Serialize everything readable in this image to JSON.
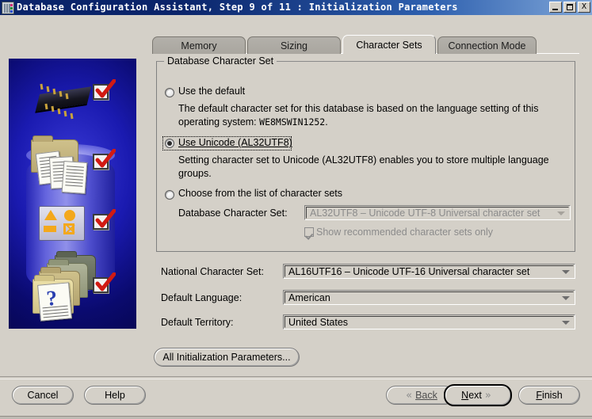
{
  "window": {
    "title": "Database Configuration Assistant, Step 9 of 11 : Initialization Parameters",
    "icon": "database-server-icon",
    "controls": {
      "minimize": "_",
      "maximize": "□",
      "close": "X"
    }
  },
  "sidebar": {
    "icon_names": [
      "chip-icon",
      "folder-documents-icon",
      "shapes-icon",
      "question-documents-icon"
    ],
    "check_marks": 4
  },
  "tabs": [
    {
      "label": "Memory",
      "active": false
    },
    {
      "label": "Sizing",
      "active": false
    },
    {
      "label": "Character Sets",
      "active": true
    },
    {
      "label": "Connection Mode",
      "active": false
    }
  ],
  "group": {
    "title": "Database Character Set",
    "options": [
      {
        "id": "use-default",
        "label": "Use the default",
        "selected": false,
        "description_line1": "The default character set for this database is based on the language setting of this",
        "description_line2_prefix": "operating system: ",
        "description_line2_value": "WE8MSWIN1252",
        "description_line2_suffix": "."
      },
      {
        "id": "use-unicode",
        "label": "Use Unicode (AL32UTF8)",
        "selected": true,
        "focused": true,
        "description_line1": "Setting character set to Unicode (AL32UTF8) enables you to store multiple language",
        "description_line2": "groups."
      },
      {
        "id": "choose-from-list",
        "label": "Choose from the list of character sets",
        "selected": false
      }
    ],
    "database_character_set": {
      "label": "Database Character Set:",
      "value": "AL32UTF8 – Unicode UTF-8 Universal character set",
      "disabled": true
    },
    "show_recommended": {
      "label": "Show recommended character sets only",
      "checked": true,
      "disabled": true
    }
  },
  "fields": [
    {
      "id": "national-character-set",
      "label": "National Character Set:",
      "value": "AL16UTF16 – Unicode UTF-16 Universal character set"
    },
    {
      "id": "default-language",
      "label": "Default Language:",
      "value": "American"
    },
    {
      "id": "default-territory",
      "label": "Default Territory:",
      "value": "United States"
    }
  ],
  "all_params_button": {
    "label": "All Initialization Parameters..."
  },
  "footer": {
    "cancel": "Cancel",
    "help": "Help",
    "back": "Back",
    "back_chevron": "«",
    "next": "Next",
    "next_chevron": "»",
    "finish": "Finish"
  },
  "colors": {
    "titlebar_start": "#0a246a",
    "titlebar_end": "#7fa6d8",
    "face": "#d4d0c8",
    "tab_inactive": "#a9a69f",
    "sidebar_blue": "#1a1ab0",
    "accent_check": "#d11a13",
    "disabled_text": "#8b8b8b"
  }
}
